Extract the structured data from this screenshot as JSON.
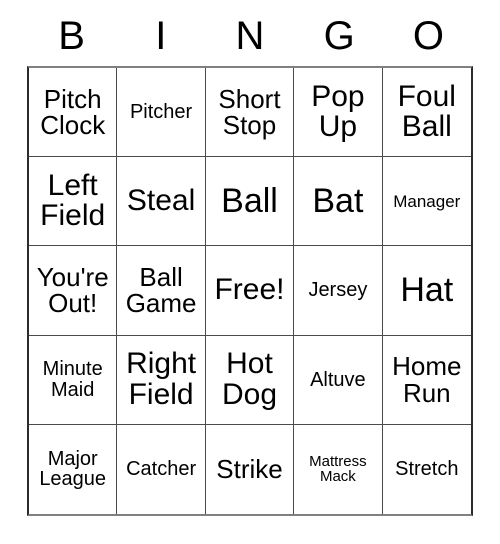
{
  "card": {
    "title": "BINGO",
    "header_letters": [
      "B",
      "I",
      "N",
      "G",
      "O"
    ],
    "background_color": "#ffffff",
    "text_color": "#000000",
    "border_color": "#4a4a4a",
    "rows": 5,
    "columns": 5,
    "free_space_label": "Free!",
    "free_space_position": "row3-col3",
    "theme": "Baseball / Houston Astros",
    "cells": [
      [
        {
          "label": "Pitch\nClock",
          "text": "Pitch Clock",
          "size": "md",
          "lines": 2
        },
        {
          "label": "Pitcher",
          "text": "Pitcher",
          "size": "sm",
          "lines": 1
        },
        {
          "label": "Short\nStop",
          "text": "Short Stop",
          "size": "md",
          "lines": 2
        },
        {
          "label": "Pop\nUp",
          "text": "Pop Up",
          "size": "lg",
          "lines": 2
        },
        {
          "label": "Foul\nBall",
          "text": "Foul Ball",
          "size": "lg",
          "lines": 2
        }
      ],
      [
        {
          "label": "Left\nField",
          "text": "Left Field",
          "size": "lg",
          "lines": 2
        },
        {
          "label": "Steal",
          "text": "Steal",
          "size": "lg",
          "lines": 1
        },
        {
          "label": "Ball",
          "text": "Ball",
          "size": "xl",
          "lines": 1
        },
        {
          "label": "Bat",
          "text": "Bat",
          "size": "xl",
          "lines": 1
        },
        {
          "label": "Manager",
          "text": "Manager",
          "size": "xs",
          "lines": 1
        }
      ],
      [
        {
          "label": "You're\nOut!",
          "text": "You're Out!",
          "size": "md",
          "lines": 2
        },
        {
          "label": "Ball\nGame",
          "text": "Ball Game",
          "size": "md",
          "lines": 2
        },
        {
          "label": "Free!",
          "text": "Free!",
          "size": "lg",
          "lines": 1
        },
        {
          "label": "Jersey",
          "text": "Jersey",
          "size": "sm",
          "lines": 1
        },
        {
          "label": "Hat",
          "text": "Hat",
          "size": "xl",
          "lines": 1
        }
      ],
      [
        {
          "label": "Minute\nMaid",
          "text": "Minute Maid",
          "size": "sm",
          "lines": 2
        },
        {
          "label": "Right\nField",
          "text": "Right Field",
          "size": "lg",
          "lines": 2
        },
        {
          "label": "Hot\nDog",
          "text": "Hot Dog",
          "size": "lg",
          "lines": 2
        },
        {
          "label": "Altuve",
          "text": "Altuve",
          "size": "sm",
          "lines": 1
        },
        {
          "label": "Home\nRun",
          "text": "Home Run",
          "size": "md",
          "lines": 2
        }
      ],
      [
        {
          "label": "Major\nLeague",
          "text": "Major League",
          "size": "sm",
          "lines": 2
        },
        {
          "label": "Catcher",
          "text": "Catcher",
          "size": "sm",
          "lines": 1
        },
        {
          "label": "Strike",
          "text": "Strike",
          "size": "md",
          "lines": 1
        },
        {
          "label": "Mattress\nMack",
          "text": "Mattress Mack",
          "size": "xxs",
          "lines": 2
        },
        {
          "label": "Stretch",
          "text": "Stretch",
          "size": "sm",
          "lines": 1
        }
      ]
    ]
  }
}
